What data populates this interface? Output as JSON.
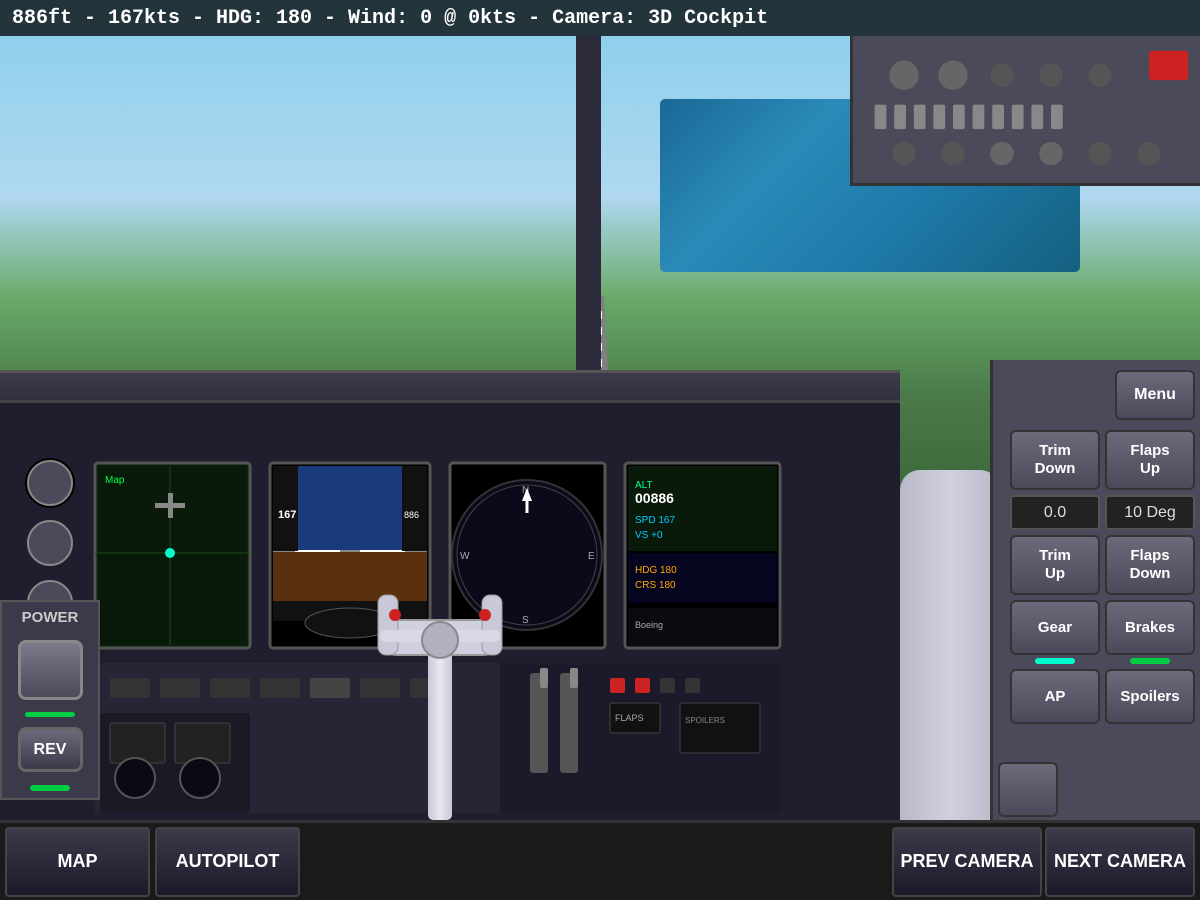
{
  "statusBar": {
    "text": "886ft - 167kts - HDG: 180 - Wind: 0 @ 0kts - Camera: 3D Cockpit"
  },
  "rightPanel": {
    "menuButton": "Menu",
    "trimDown": "Trim\nDown",
    "flapsUp": "Flaps\nUp",
    "trimValue": "0.0",
    "flapsValue": "10 Deg",
    "trimUp": "Trim\nUp",
    "flapsDown": "Flaps\nDown",
    "gear": "Gear",
    "brakes": "Brakes",
    "ap": "AP",
    "spoilers": "Spoilers",
    "gearIndicatorColor": "#00ccbb",
    "brakesIndicatorColor": "#00cc44"
  },
  "leftPanel": {
    "powerLabel": "POWER",
    "revLabel": "REV"
  },
  "bottomBar": {
    "mapLabel": "MAP",
    "autopilotLabel": "AUTOPILOT",
    "prevCameraLabel": "PREV CAMERA",
    "nextCameraLabel": "NEXT CAMERA"
  }
}
